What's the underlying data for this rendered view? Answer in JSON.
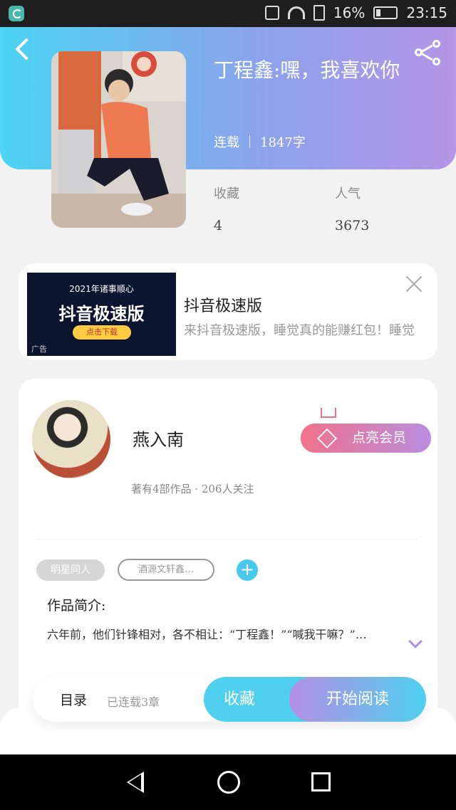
{
  "statusbar": {
    "battery": "16%",
    "time": "23:15"
  },
  "book": {
    "title": "丁程鑫:嘿，我喜欢你",
    "status": "连载",
    "words": "1847字",
    "favorites_label": "收藏",
    "favorites_value": "4",
    "popularity_label": "人气",
    "popularity_value": "3673"
  },
  "ad": {
    "image_line1": "2021年诸事顺心",
    "image_line2": "抖音极速版",
    "image_button": "点击下载",
    "image_tag": "广告",
    "title": "抖音极速版",
    "desc": "来抖音极速版，睡觉真的能赚红包！睡觉"
  },
  "author": {
    "name": "燕入南",
    "meta": "著有4部作品 · 206人关注",
    "vip_button": "点亮会员"
  },
  "tags": [
    "明星同人",
    "酒源文轩鑫…"
  ],
  "intro": {
    "title": "作品简介:",
    "text": "六年前，他们针锋相对，各不相让：“丁程鑫！”“喊我干嘛？”…"
  },
  "actions": {
    "toc": "目录",
    "toc_sub": "已连载3章",
    "collect": "收藏",
    "read": "开始阅读"
  }
}
